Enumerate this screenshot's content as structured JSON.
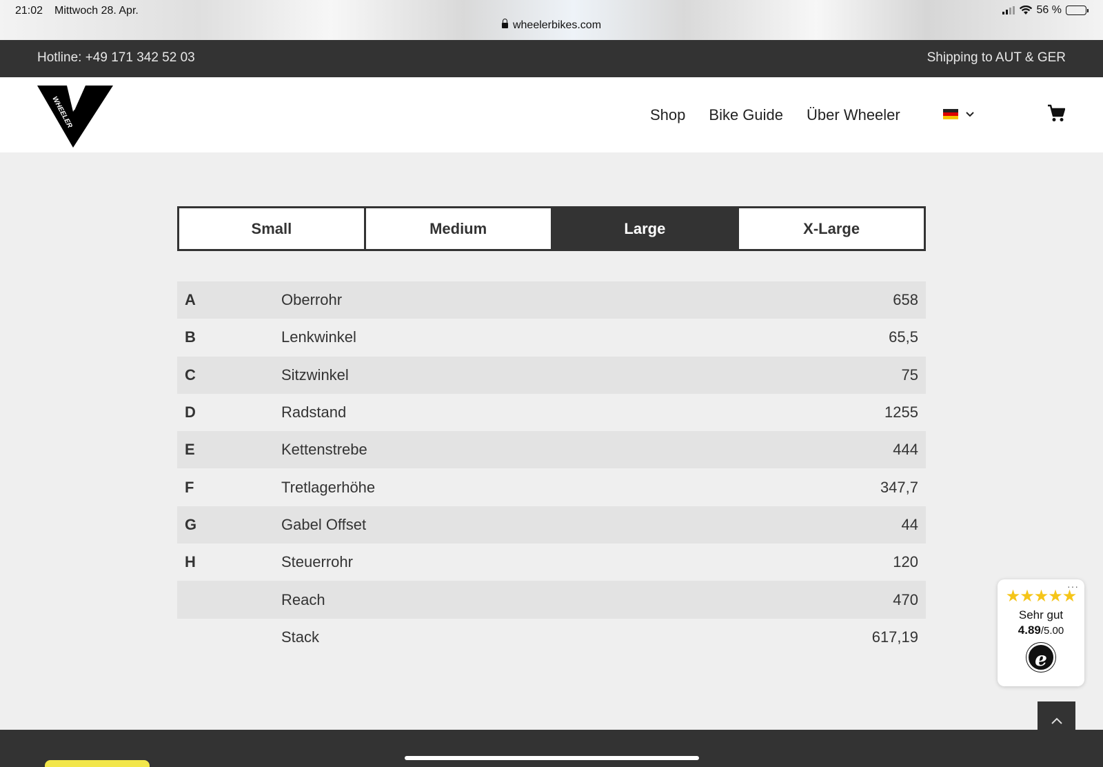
{
  "status_bar": {
    "time": "21:02",
    "date": "Mittwoch 28. Apr.",
    "url": "wheelerbikes.com",
    "battery": "56 %",
    "battery_level": 0.56
  },
  "topbar": {
    "hotline": "Hotline: +49 171 342 52 03",
    "shipping": "Shipping to AUT & GER"
  },
  "logo": {
    "text": "WHEELER"
  },
  "nav": {
    "shop": "Shop",
    "bike_guide": "Bike Guide",
    "about": "Über Wheeler",
    "language": "de",
    "icons": [
      "flag-de-icon",
      "chevron-down-icon",
      "cart-icon"
    ]
  },
  "size_tabs": {
    "small": "Small",
    "medium": "Medium",
    "large": "Large",
    "xlarge": "X-Large",
    "active": "Large"
  },
  "geometry": {
    "rows": [
      {
        "letter": "A",
        "name": "Oberrohr",
        "value": "658"
      },
      {
        "letter": "B",
        "name": "Lenkwinkel",
        "value": "65,5"
      },
      {
        "letter": "C",
        "name": "Sitzwinkel",
        "value": "75"
      },
      {
        "letter": "D",
        "name": "Radstand",
        "value": "1255"
      },
      {
        "letter": "E",
        "name": "Kettenstrebe",
        "value": "444"
      },
      {
        "letter": "F",
        "name": "Tretlagerhöhe",
        "value": "347,7"
      },
      {
        "letter": "G",
        "name": "Gabel Offset",
        "value": "44"
      },
      {
        "letter": "H",
        "name": "Steuerrohr",
        "value": "120"
      },
      {
        "letter": "",
        "name": "Reach",
        "value": "470"
      },
      {
        "letter": "",
        "name": "Stack",
        "value": "617,19"
      }
    ]
  },
  "trusted": {
    "stars": "★★★★★",
    "label": "Sehr gut",
    "score": "4.89",
    "max": "/5.00",
    "logo": "e"
  },
  "colors": {
    "dark": "#333333",
    "star": "#f5c518",
    "yellow_button": "#f2e64a"
  }
}
